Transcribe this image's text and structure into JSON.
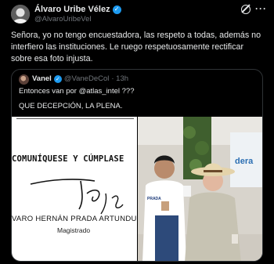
{
  "author": {
    "name": "Álvaro Uribe Vélez",
    "handle": "@AlvaroUribeVel"
  },
  "tweet": {
    "text": "Señora, yo no tengo encuestadora, las respeto a todas, además no interfiero las instituciones. Le ruego respetuosamente rectificar sobre esa foto injusta."
  },
  "quote": {
    "name": "Vanel",
    "handle": "@VaneDeCol",
    "time": "· 13h",
    "line1": "Entonces van por @atlas_intel ???",
    "line2": "QUE DECEPCIÓN, LA PLENA.",
    "document": {
      "comuniquese": "COMUNÍQUESE Y CÚMPLASE",
      "firma_name": "VARO HERNÁN PRADA ARTUNDUAGA",
      "role": "Magistrado"
    },
    "photo": {
      "shirt_text_left": "PRADA",
      "sign_text": "dera"
    }
  },
  "colors": {
    "verified": "#1d9bf0",
    "text": "#e7e9ea",
    "muted": "#71767b",
    "border": "#2f3336"
  }
}
